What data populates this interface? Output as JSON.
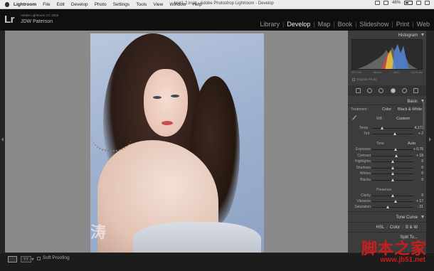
{
  "menubar": {
    "items": [
      "Lightroom",
      "File",
      "Edit",
      "Develop",
      "Photo",
      "Settings",
      "Tools",
      "View",
      "Window",
      "Help"
    ],
    "window_title": "test1-2.lrcat - Adobe Photoshop Lightroom - Develop",
    "battery": "48%"
  },
  "identity": {
    "logo": "Lr",
    "version": "Adobe Lightroom CC 2015",
    "name": "JDW Paterson"
  },
  "modules": [
    "Library",
    "Develop",
    "Map",
    "Book",
    "Slideshow",
    "Print",
    "Web"
  ],
  "active_module": "Develop",
  "photo": {
    "watermark": "涛"
  },
  "histogram": {
    "title": "Histogram",
    "info": [
      "ISO 100",
      "85 mm",
      "f/8.0",
      "1/125 sec"
    ],
    "original_photo": "Original Photo"
  },
  "basic": {
    "title": "Basic",
    "treatment_label": "Treatment :",
    "color": "Color",
    "bw": "Black & White",
    "wb_label": "WB :",
    "wb_value": "Custom",
    "temp_label": "Temp",
    "temp_value": "4,173",
    "tint_label": "Tint",
    "tint_value": "+ 2",
    "tone_label": "Tone",
    "auto": "Auto",
    "sliders": [
      {
        "label": "Exposure",
        "value": "+ 0.75",
        "pos": 0.58
      },
      {
        "label": "Contrast",
        "value": "+ 18",
        "pos": 0.6
      },
      {
        "label": "Highlights",
        "value": "0",
        "pos": 0.5
      },
      {
        "label": "Shadows",
        "value": "0",
        "pos": 0.5
      },
      {
        "label": "Whites",
        "value": "0",
        "pos": 0.5
      },
      {
        "label": "Blacks",
        "value": "0",
        "pos": 0.5
      }
    ],
    "presence_label": "Presence",
    "presence": [
      {
        "label": "Clarity",
        "value": "0",
        "pos": 0.5
      },
      {
        "label": "Vibrance",
        "value": "+ 17",
        "pos": 0.58
      },
      {
        "label": "Saturation",
        "value": "- 21",
        "pos": 0.39
      }
    ]
  },
  "panels": {
    "tone_curve": "Tone Curve",
    "hsl": "HSL",
    "hsl_color": "Color",
    "hsl_bw": "B & W",
    "split_toning": "Split To..."
  },
  "bottom": {
    "soft_proofing": "Soft Proofing"
  },
  "site_watermark": {
    "text": "脚本之家",
    "url": "www.jb51.net"
  }
}
